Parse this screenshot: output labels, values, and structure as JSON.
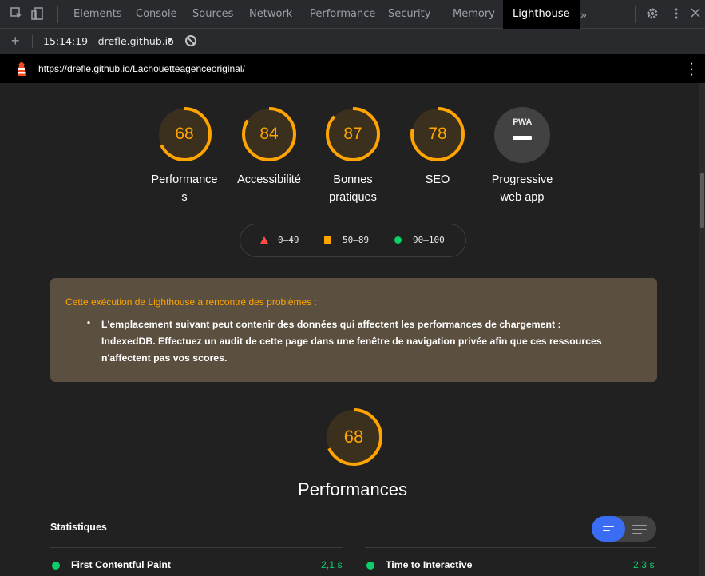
{
  "devtools": {
    "tabs": [
      "Elements",
      "Console",
      "Sources",
      "Network",
      "Performance",
      "Security",
      "Memory",
      "Lighthouse"
    ],
    "active_tab": "Lighthouse",
    "overflow": "»",
    "report_selector": "15:14:19 - drefle.github.io",
    "icons": [
      "inspect-icon",
      "device-toolbar-icon",
      "gear-icon",
      "kebab-menu-icon",
      "close-icon",
      "plus-icon",
      "block-icon"
    ]
  },
  "url": "https://drefle.github.io/Lachouetteagenceoriginal/",
  "gauges": [
    {
      "score": 68,
      "label_lines": [
        "Performance",
        "s"
      ]
    },
    {
      "score": 84,
      "label_lines": [
        "Accessibilité"
      ]
    },
    {
      "score": 87,
      "label_lines": [
        "Bonnes",
        "pratiques"
      ]
    },
    {
      "score": 78,
      "label_lines": [
        "SEO"
      ]
    }
  ],
  "pwa": {
    "badge_text": "PWA",
    "label_lines": [
      "Progressive",
      "web app"
    ]
  },
  "legend": [
    {
      "range": "0–49",
      "color": "#ff4e42",
      "shape": "triangle"
    },
    {
      "range": "50–89",
      "color": "#ffa400",
      "shape": "square"
    },
    {
      "range": "90–100",
      "color": "#0cce6b",
      "shape": "circle"
    }
  ],
  "warning": {
    "title": "Cette exécution de Lighthouse a rencontré des problèmes :",
    "lines": [
      "L'emplacement suivant peut contenir des données qui affectent les performances de chargement :",
      "IndexedDB. Effectuez un audit de cette page dans une fenêtre de navigation privée afin que ces ressources",
      "n'affectent pas vos scores."
    ]
  },
  "performance_section": {
    "score": 68,
    "title": "Performances",
    "stats_title": "Statistiques",
    "metrics": [
      {
        "name": "First Contentful Paint",
        "value": "2,1 s"
      },
      {
        "name": "Time to Interactive",
        "value": "2,3 s"
      }
    ]
  },
  "colors": {
    "orange": "#ffa400",
    "green": "#0cce6b",
    "red": "#ff4e42",
    "accent": "#3a6cf4"
  }
}
